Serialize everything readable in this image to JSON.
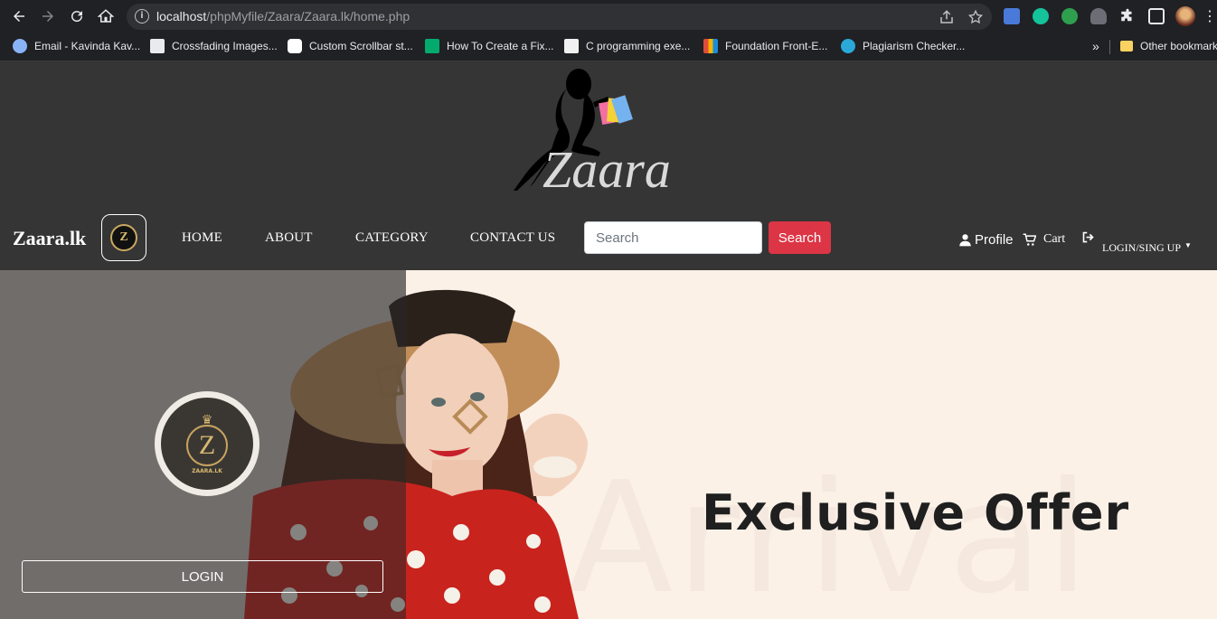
{
  "browser": {
    "url_host": "localhost",
    "url_path": "/phpMyfile/Zaara/Zaara.lk/home.php",
    "bookmarks": [
      {
        "label": "Email - Kavinda Kav...",
        "icon": "globe-icon"
      },
      {
        "label": "Crossfading Images...",
        "icon": "css3-icon"
      },
      {
        "label": "Custom Scrollbar st...",
        "icon": "codepen-icon"
      },
      {
        "label": "How To Create a Fix...",
        "icon": "w3schools-icon"
      },
      {
        "label": "C programming exe...",
        "icon": "w3r-icon"
      },
      {
        "label": "Foundation Front-E...",
        "icon": "foundation-icon"
      },
      {
        "label": "Plagiarism Checker...",
        "icon": "plagiarism-icon"
      }
    ],
    "other_bookmarks": "Other bookmarks",
    "overflow": "»"
  },
  "site": {
    "logo_text": "Zaara",
    "brand": "Zaara.lk",
    "badge_letter": "Z",
    "nav": [
      {
        "label": "HOME"
      },
      {
        "label": "ABOUT"
      },
      {
        "label": "CATEGORY"
      },
      {
        "label": "CONTACT US"
      }
    ],
    "search_placeholder": "Search",
    "search_button": "Search",
    "profile": "Profile",
    "cart": "Cart",
    "login_signup": "LOGIN/SING UP"
  },
  "hero": {
    "logo_letter": "Z",
    "logo_caption": "ZAARA.LK",
    "login_button": "LOGIN",
    "headline": "Exclusive Offer",
    "watermark": "Arrival"
  },
  "colors": {
    "header_bg": "#353535",
    "search_button": "#dc3545",
    "hero_bg": "#fbf1e7",
    "dress_red": "#c9231e"
  }
}
